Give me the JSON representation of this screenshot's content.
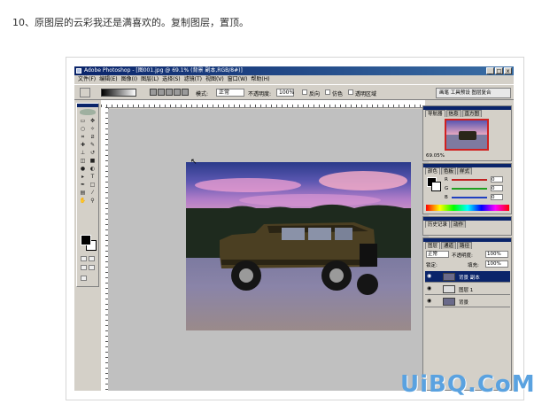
{
  "caption": "10、原图层的云彩我还是满喜欢的。复制图层，置顶。",
  "window": {
    "title": "Adobe Photoshop - [图001.jpg @ 69.1% (背景 副本,RGB/8#)]",
    "controls": [
      "_",
      "□",
      "x"
    ]
  },
  "menu": [
    "文件(F)",
    "编辑(E)",
    "图像(I)",
    "图层(L)",
    "选择(S)",
    "滤镜(T)",
    "视图(V)",
    "窗口(W)",
    "帮助(H)"
  ],
  "options": {
    "mode_label": "模式:",
    "mode_value": "正常",
    "opacity_label": "不透明度:",
    "opacity_value": "100%",
    "reverse_label": "反向",
    "dither_label": "仿色",
    "transparency_label": "透明区域",
    "palette_btn": "画笔  工具预设  图层复合"
  },
  "navigator": {
    "tabs": [
      "导航器",
      "信息",
      "直方图"
    ],
    "zoom": "69.05%"
  },
  "color": {
    "tabs": [
      "颜色",
      "色板",
      "样式"
    ],
    "channels": [
      {
        "label": "R",
        "value": "0",
        "color": "#c02020"
      },
      {
        "label": "G",
        "value": "0",
        "color": "#20a020"
      },
      {
        "label": "B",
        "value": "0",
        "color": "#2040c0"
      }
    ]
  },
  "history": {
    "tabs": [
      "历史记录",
      "动作"
    ]
  },
  "layers": {
    "tabs": [
      "图层",
      "通道",
      "路径"
    ],
    "blend": "正常",
    "opacity_label": "不透明度:",
    "opacity_value": "100%",
    "lock_label": "锁定:",
    "fill_label": "填充:",
    "fill_value": "100%",
    "rows": [
      {
        "name": "背景 副本",
        "selected": true
      },
      {
        "name": "图层 1",
        "selected": false
      },
      {
        "name": "背景",
        "selected": false
      }
    ]
  },
  "watermark": {
    "main": "UiBQ.CoM",
    "sub": ""
  },
  "colors": {
    "title_bar": "#0a246a",
    "ui_gray": "#d4d0c8",
    "watermark": "#5aa2e0"
  }
}
